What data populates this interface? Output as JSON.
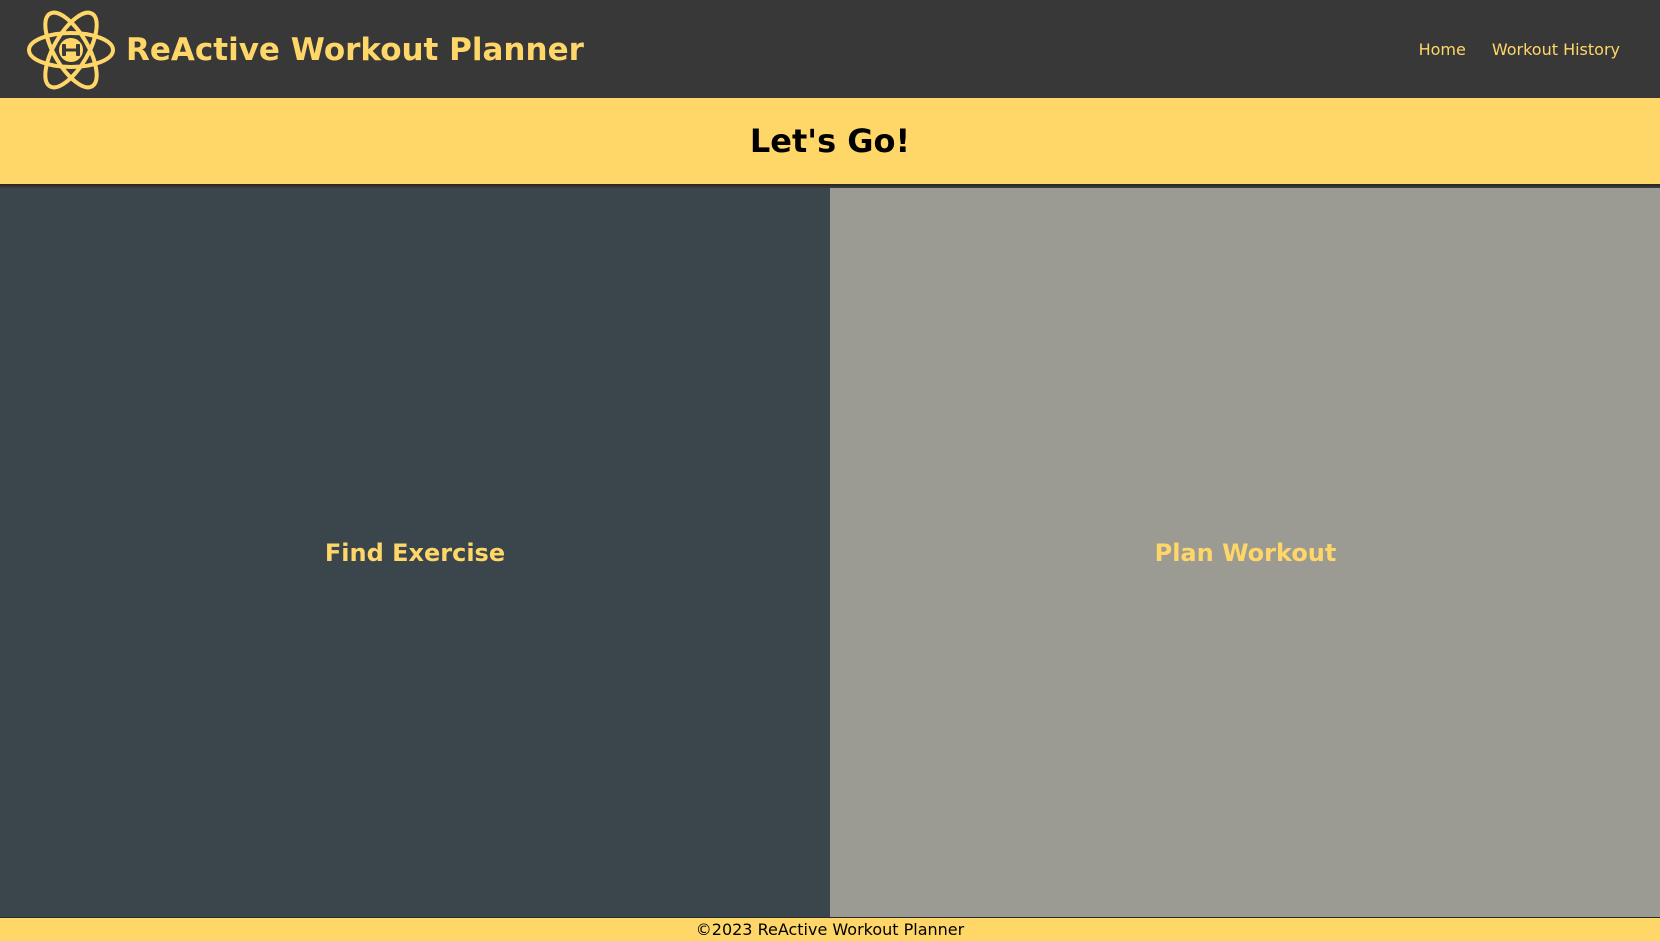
{
  "colors": {
    "accent": "#ffd769",
    "navbar_bg": "#383838",
    "left_panel_bg": "#3b464c",
    "right_panel_bg": "#9b9a93",
    "text_dark": "#000000"
  },
  "navbar": {
    "brand_title": "ReActive Workout Planner",
    "logo_icon": "atom-dumbbell-logo-icon",
    "links": [
      {
        "label": "Home"
      },
      {
        "label": "Workout History"
      }
    ]
  },
  "hero": {
    "heading": "Let's Go!"
  },
  "panels": {
    "left": {
      "label": "Find Exercise"
    },
    "right": {
      "label": "Plan Workout"
    }
  },
  "footer": {
    "text": "©2023 ReActive Workout Planner"
  }
}
